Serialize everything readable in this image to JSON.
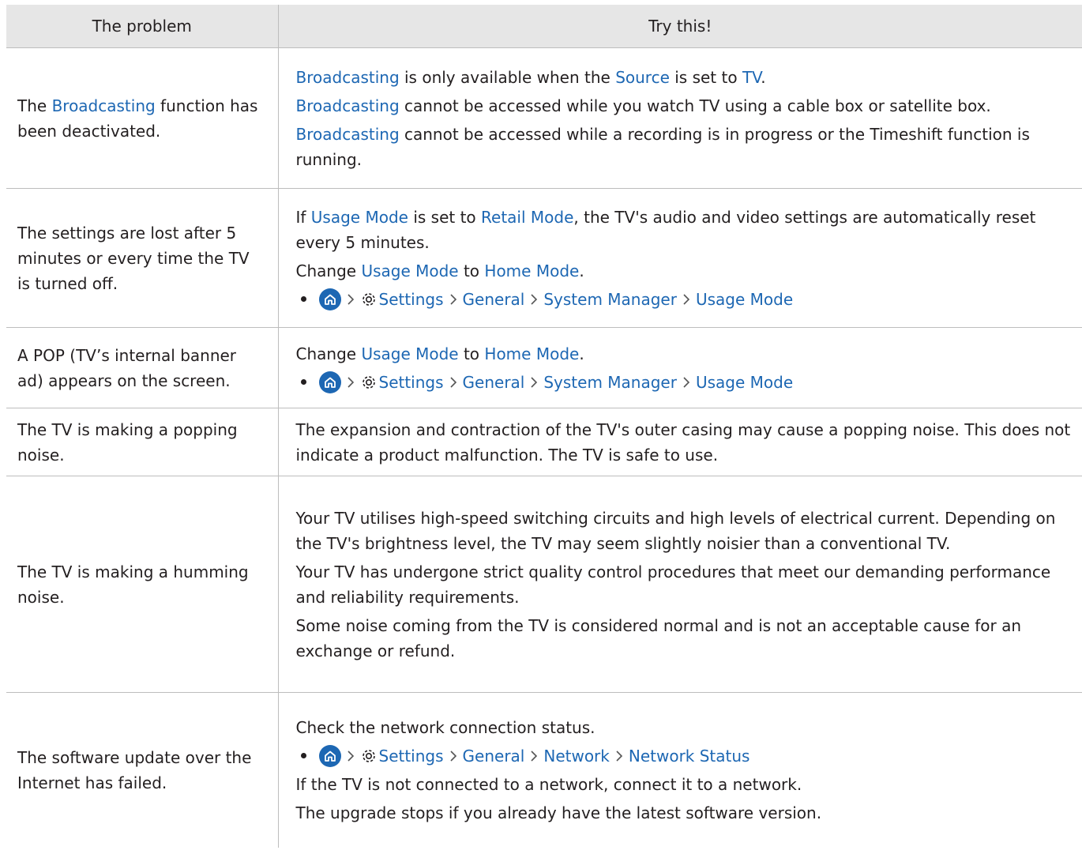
{
  "table": {
    "headers": {
      "problem": "The problem",
      "solution": "Try this!"
    },
    "rows": [
      {
        "problem": {
          "before": "The ",
          "link": "Broadcasting",
          "after": " function has been deactivated."
        },
        "s1": {
          "a": "Broadcasting",
          "b": " is only available when the ",
          "c": "Source",
          "d": " is set to ",
          "e": "TV",
          "f": "."
        },
        "s2": {
          "a": "Broadcasting",
          "b": " cannot be accessed while you watch TV using a cable box or satellite box."
        },
        "s3": {
          "a": "Broadcasting",
          "b": " cannot be accessed while a recording is in progress or the Timeshift function is running."
        }
      },
      {
        "problem": "The settings are lost after 5 minutes or every time the TV is turned off.",
        "s1": {
          "a": "If ",
          "b": "Usage Mode",
          "c": " is set to ",
          "d": "Retail Mode",
          "e": ", the TV's audio and video settings are automatically reset every 5 minutes."
        },
        "s2": {
          "a": "Change ",
          "b": "Usage Mode",
          "c": " to ",
          "d": "Home Mode",
          "e": "."
        },
        "path": {
          "settings": "Settings",
          "general": "General",
          "manager": "System Manager",
          "mode": "Usage Mode"
        }
      },
      {
        "problem": "A POP (TV’s internal banner ad) appears on the screen.",
        "s1": {
          "a": "Change ",
          "b": "Usage Mode",
          "c": " to ",
          "d": "Home Mode",
          "e": "."
        },
        "path": {
          "settings": "Settings",
          "general": "General",
          "manager": "System Manager",
          "mode": "Usage Mode"
        }
      },
      {
        "problem": "The TV is making a popping noise.",
        "s1": "The expansion and contraction of the TV's outer casing may cause a popping noise. This does not indicate a product malfunction. The TV is safe to use."
      },
      {
        "problem": "The TV is making a humming noise.",
        "s1": "Your TV utilises high-speed switching circuits and high levels of electrical current. Depending on the TV's brightness level, the TV may seem slightly noisier than a conventional TV.",
        "s2": "Your TV has undergone strict quality control procedures that meet our demanding performance and reliability requirements.",
        "s3": "Some noise coming from the TV is considered normal and is not an acceptable cause for an exchange or refund."
      },
      {
        "problem": "The software update over the Internet has failed.",
        "s1": "Check the network connection status.",
        "path": {
          "settings": "Settings",
          "general": "General",
          "network": "Network",
          "status": "Network Status"
        },
        "s2": "If the TV is not connected to a network, connect it to a network.",
        "s3": "The upgrade stops if you already have the latest software version."
      }
    ]
  },
  "icons": {
    "home": "home-icon",
    "settings": "gear-icon",
    "separator": "chevron-right-icon",
    "bullet": "bullet-icon"
  },
  "colors": {
    "link": "#1d67b3",
    "header_bg": "#e6e6e6",
    "border": "#bdbdbd"
  }
}
